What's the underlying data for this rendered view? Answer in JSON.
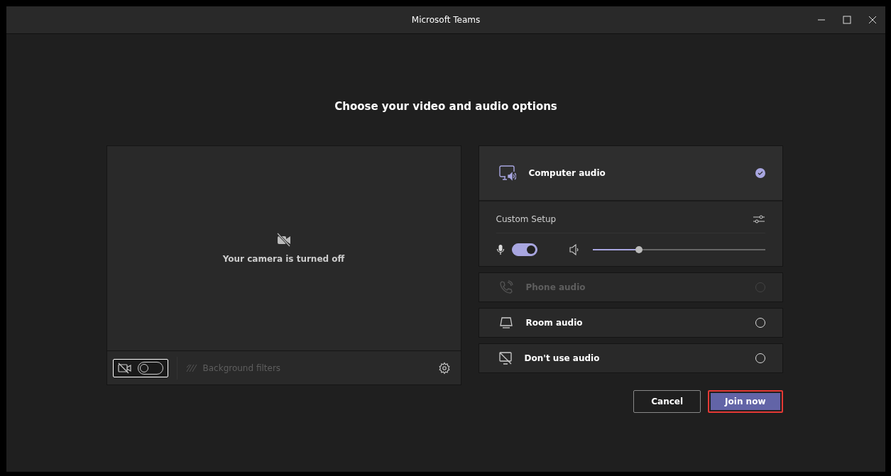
{
  "window": {
    "title": "Microsoft Teams"
  },
  "heading": "Choose your video and audio options",
  "video": {
    "message": "Your camera is turned off",
    "camera_on": false,
    "background_filters": {
      "label": "Background filters",
      "disabled": true
    }
  },
  "audio_options": [
    {
      "kind": "computer",
      "label": "Computer audio",
      "selected": true,
      "disabled": false,
      "custom_setup": {
        "label": "Custom Setup",
        "mic_on": true,
        "volume": {
          "level": 0.27
        }
      }
    },
    {
      "kind": "phone",
      "label": "Phone audio",
      "selected": false,
      "disabled": true
    },
    {
      "kind": "room",
      "label": "Room audio",
      "selected": false,
      "disabled": false
    },
    {
      "kind": "none",
      "label": "Don't use audio",
      "selected": false,
      "disabled": false
    }
  ],
  "buttons": [
    {
      "kind": "secondary",
      "label": "Cancel",
      "highlighted": false
    },
    {
      "kind": "primary",
      "label": "Join now",
      "highlighted": true
    }
  ]
}
